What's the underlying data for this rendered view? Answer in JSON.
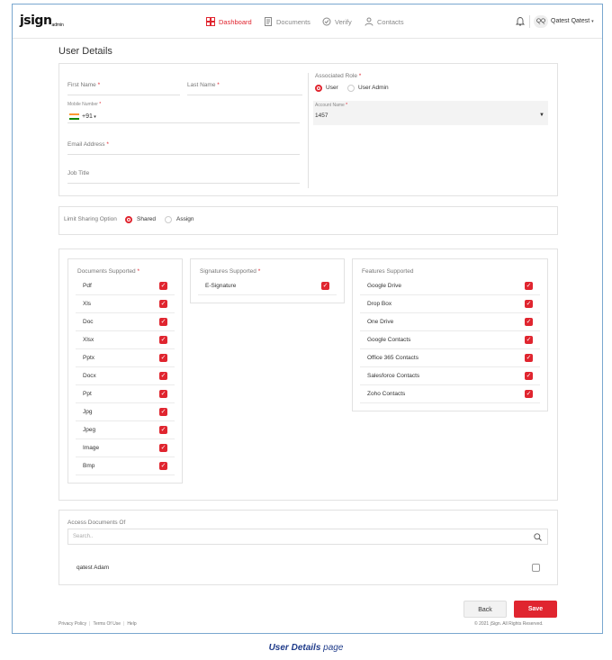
{
  "brand": {
    "logo_main": "jsign",
    "logo_sub": "admin"
  },
  "nav": {
    "dashboard": "Dashboard",
    "documents": "Documents",
    "verify": "Verify",
    "contacts": "Contacts"
  },
  "user": {
    "initials": "QQ",
    "name": "Qatest Qatest"
  },
  "page_title": "User Details",
  "form": {
    "first_name_label": "First Name",
    "last_name_label": "Last Name",
    "mobile_label": "Mobile Number",
    "country_code": "+91",
    "email_label": "Email Address",
    "job_title_label": "Job Title",
    "role_label": "Associated Role",
    "role_options": [
      "User",
      "User Admin"
    ],
    "role_selected": "User",
    "account_name_label": "Account Name",
    "account_name_value": "1457"
  },
  "sharing": {
    "label": "Limit Sharing Option",
    "options": [
      "Shared",
      "Assign"
    ],
    "selected": "Shared"
  },
  "documents_supported": {
    "title": "Documents Supported",
    "items": [
      "Pdf",
      "Xls",
      "Doc",
      "Xlsx",
      "Pptx",
      "Docx",
      "Ppt",
      "Jpg",
      "Jpeg",
      "Image",
      "Bmp"
    ]
  },
  "signatures_supported": {
    "title": "Signatures Supported",
    "items": [
      "E-Signature"
    ]
  },
  "features_supported": {
    "title": "Features Supported",
    "items": [
      "Google Drive",
      "Drop Box",
      "One Drive",
      "Google Contacts",
      "Office 365 Contacts",
      "Salesforce Contacts",
      "Zoho Contacts"
    ]
  },
  "access": {
    "title": "Access Documents Of",
    "search_placeholder": "Search..",
    "users": [
      "qatest Adam"
    ]
  },
  "buttons": {
    "back": "Back",
    "save": "Save"
  },
  "footer": {
    "privacy": "Privacy Policy",
    "terms": "Terms Of Use",
    "help": "Help",
    "copyright": "© 2021 jSign. All Rights Reserved."
  },
  "caption": {
    "bold": "User Details",
    "rest": " page"
  },
  "colors": {
    "accent": "#e0252f",
    "frame_border": "#7aa7cf",
    "caption": "#1f3b8a"
  }
}
